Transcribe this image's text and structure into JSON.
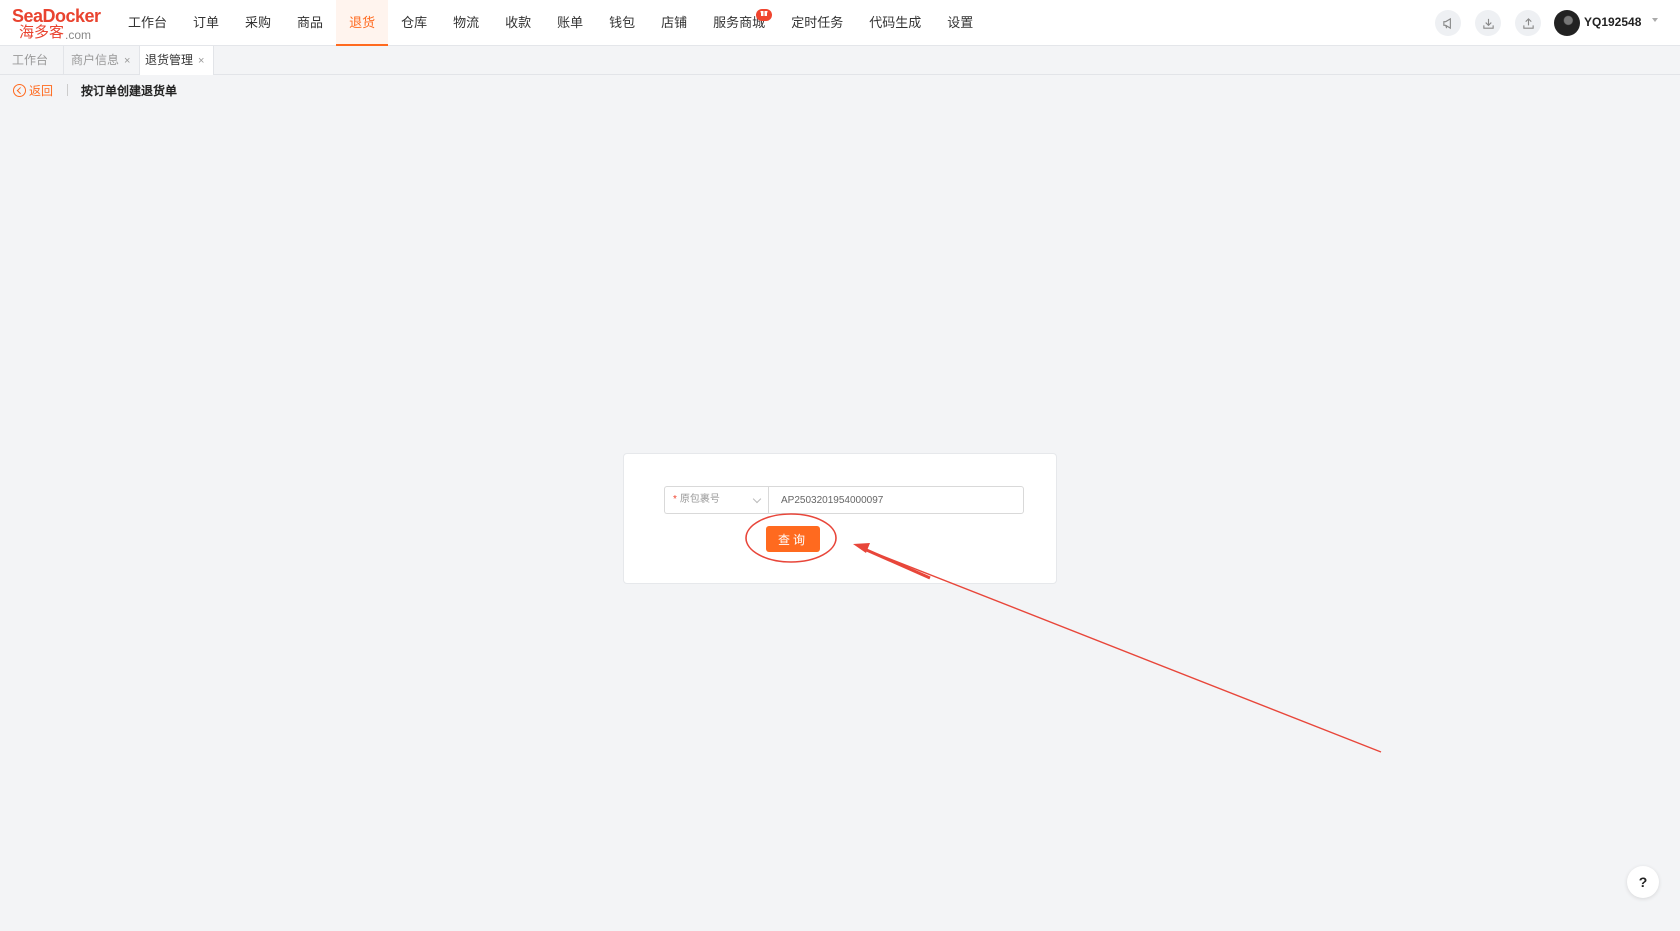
{
  "logo": {
    "brand": "SeaDocker",
    "cn": "海多客",
    "domain": ".com"
  },
  "nav": {
    "items": [
      {
        "label": "工作台"
      },
      {
        "label": "订单"
      },
      {
        "label": "采购"
      },
      {
        "label": "商品"
      },
      {
        "label": "退货",
        "active": true
      },
      {
        "label": "仓库"
      },
      {
        "label": "物流"
      },
      {
        "label": "收款"
      },
      {
        "label": "账单"
      },
      {
        "label": "钱包"
      },
      {
        "label": "店铺"
      },
      {
        "label": "服务商城",
        "badge": true
      },
      {
        "label": "定时任务"
      },
      {
        "label": "代码生成"
      },
      {
        "label": "设置"
      }
    ]
  },
  "header_tools": {
    "icons": [
      "megaphone-icon",
      "download-icon",
      "upload-icon"
    ],
    "username": "YQ192548"
  },
  "tabs": [
    {
      "label": "工作台"
    },
    {
      "label": "商户信息",
      "closable": true
    },
    {
      "label": "退货管理",
      "closable": true,
      "active": true
    }
  ],
  "tab_close": "×",
  "breadcrumb": {
    "back_label": "返回",
    "title": "按订单创建退货单"
  },
  "form": {
    "required_mark": "*",
    "field_select": "原包裹号",
    "input_value": "AP2503201954000097",
    "query_label": "查询"
  },
  "help_label": "?",
  "colors": {
    "accent": "#ff6a1f",
    "annotation": "#e8463a",
    "badge": "#f0452f"
  }
}
